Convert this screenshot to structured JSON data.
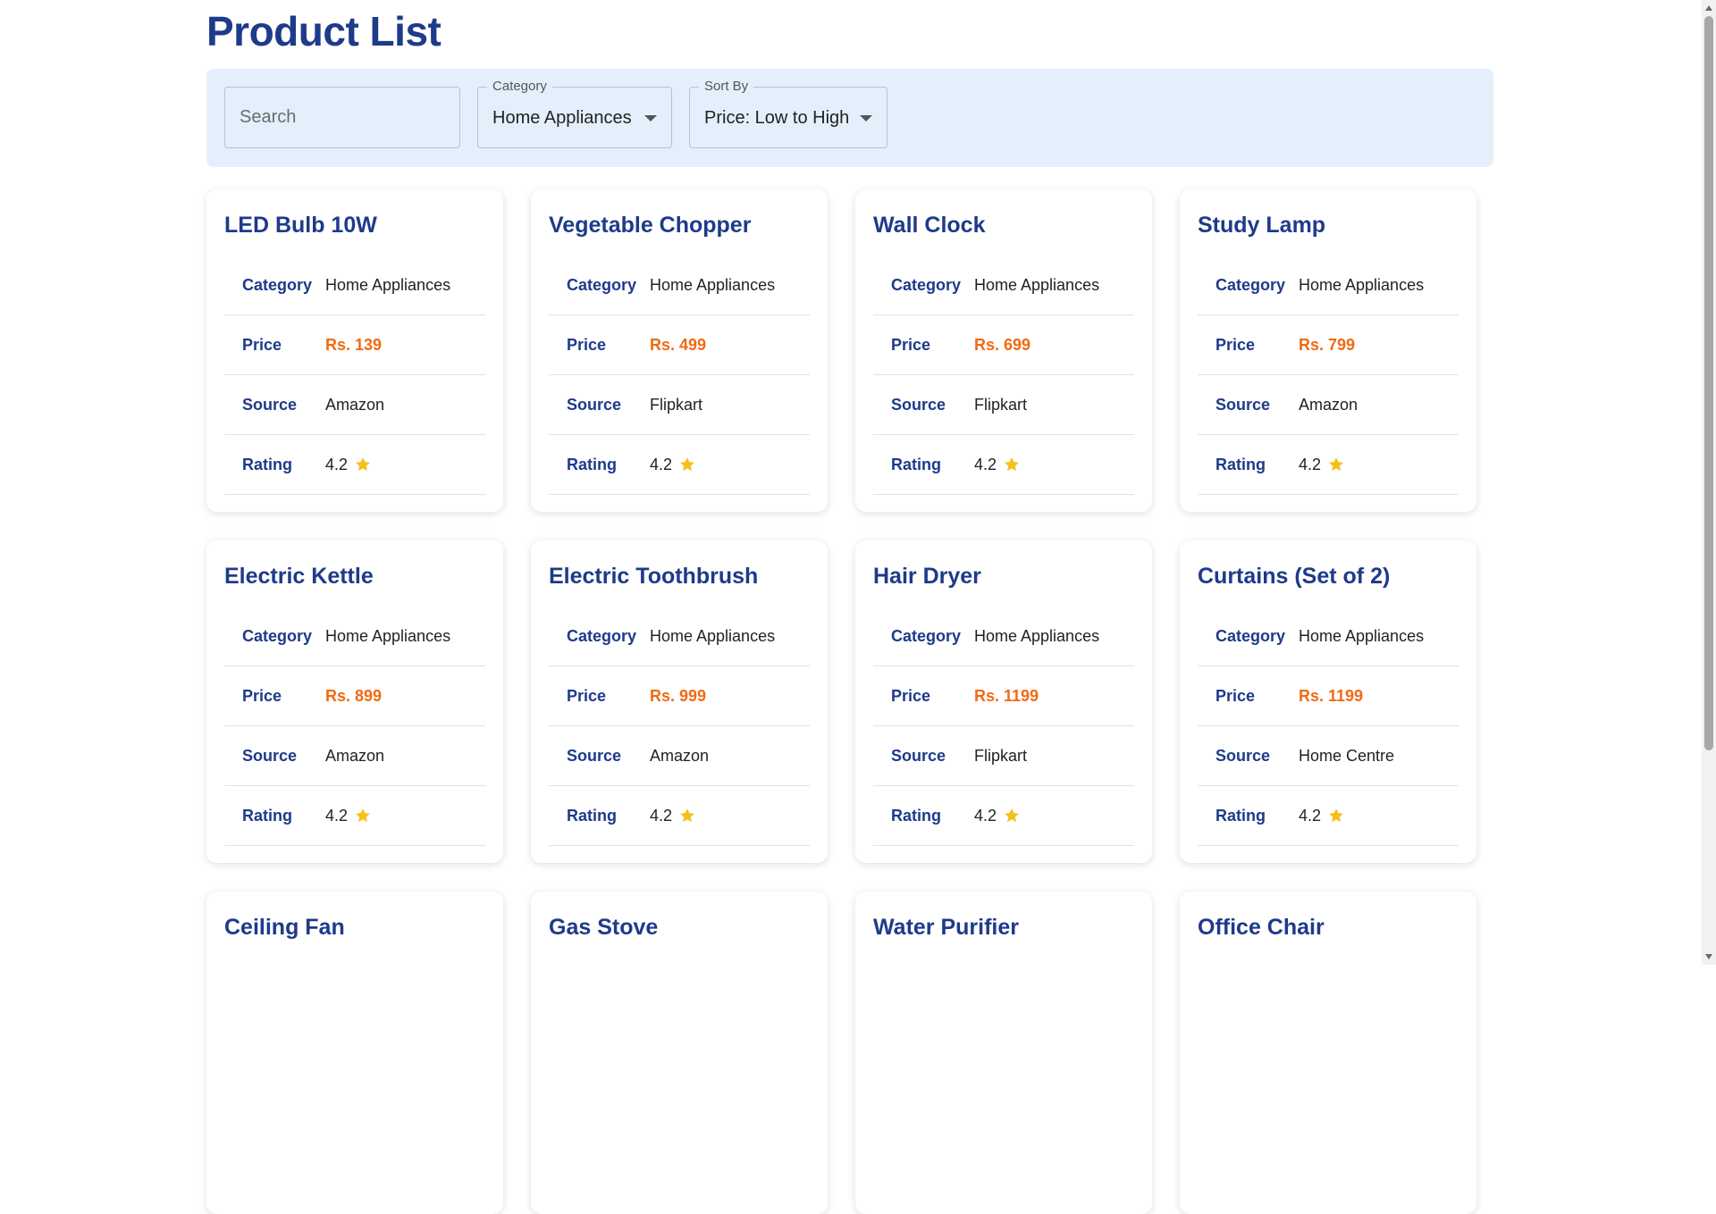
{
  "page": {
    "title": "Product List"
  },
  "filters": {
    "search_placeholder": "Search",
    "category": {
      "label": "Category",
      "value": "Home Appliances"
    },
    "sort": {
      "label": "Sort By",
      "value": "Price: Low to High"
    }
  },
  "labels": {
    "category": "Category",
    "price": "Price",
    "source": "Source",
    "rating": "Rating"
  },
  "colors": {
    "title": "#1e3a8a",
    "price": "#f26a11",
    "star": "#f4c01e",
    "filter_bg": "#e3f0fb"
  },
  "products": [
    {
      "name": "LED Bulb 10W",
      "category": "Home Appliances",
      "price": "Rs. 139",
      "source": "Amazon",
      "rating": "4.2"
    },
    {
      "name": "Vegetable Chopper",
      "category": "Home Appliances",
      "price": "Rs. 499",
      "source": "Flipkart",
      "rating": "4.2"
    },
    {
      "name": "Wall Clock",
      "category": "Home Appliances",
      "price": "Rs. 699",
      "source": "Flipkart",
      "rating": "4.2"
    },
    {
      "name": "Study Lamp",
      "category": "Home Appliances",
      "price": "Rs. 799",
      "source": "Amazon",
      "rating": "4.2"
    },
    {
      "name": "Electric Kettle",
      "category": "Home Appliances",
      "price": "Rs. 899",
      "source": "Amazon",
      "rating": "4.2"
    },
    {
      "name": "Electric Toothbrush",
      "category": "Home Appliances",
      "price": "Rs. 999",
      "source": "Amazon",
      "rating": "4.2"
    },
    {
      "name": "Hair Dryer",
      "category": "Home Appliances",
      "price": "Rs. 1199",
      "source": "Flipkart",
      "rating": "4.2"
    },
    {
      "name": "Curtains (Set of 2)",
      "category": "Home Appliances",
      "price": "Rs. 1199",
      "source": "Home Centre",
      "rating": "4.2"
    },
    {
      "name": "Ceiling Fan"
    },
    {
      "name": "Gas Stove"
    },
    {
      "name": "Water Purifier"
    },
    {
      "name": "Office Chair"
    }
  ]
}
